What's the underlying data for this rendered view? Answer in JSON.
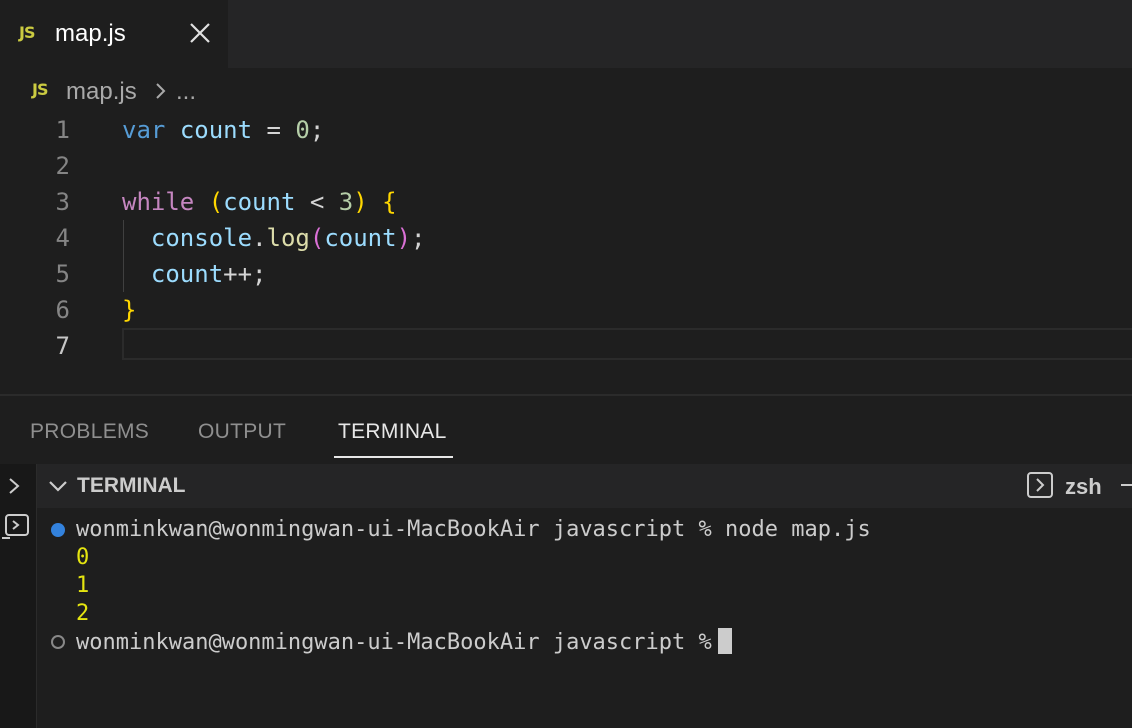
{
  "tab": {
    "icon": "JS",
    "label": "map.js"
  },
  "breadcrumb": {
    "icon": "JS",
    "file": "map.js",
    "ellipsis": "..."
  },
  "editor": {
    "line_numbers": [
      "1",
      "2",
      "3",
      "4",
      "5",
      "6",
      "7"
    ],
    "active_line": 7,
    "lines": [
      "var count = 0;",
      "",
      "while (count < 3) {",
      "  console.log(count);",
      "  count++;",
      "}",
      ""
    ]
  },
  "panel": {
    "tabs": [
      {
        "label": "PROBLEMS"
      },
      {
        "label": "OUTPUT"
      },
      {
        "label": "TERMINAL",
        "active": true
      }
    ]
  },
  "terminal": {
    "title": "TERMINAL",
    "shell": "zsh",
    "prompt_1": "wonminkwan@wonmingwan-ui-MacBookAir javascript % node map.js",
    "outputs": [
      "0",
      "1",
      "2"
    ],
    "prompt_2": "wonminkwan@wonmingwan-ui-MacBookAir javascript %"
  },
  "colors": {
    "keyword_decl": "#569cd6",
    "keyword_control": "#c586c0",
    "variable": "#9cdcfe",
    "number": "#b5cea8",
    "function": "#dcdcaa",
    "terminal_output": "#e5e510",
    "js_badge": "#cbcb41"
  }
}
